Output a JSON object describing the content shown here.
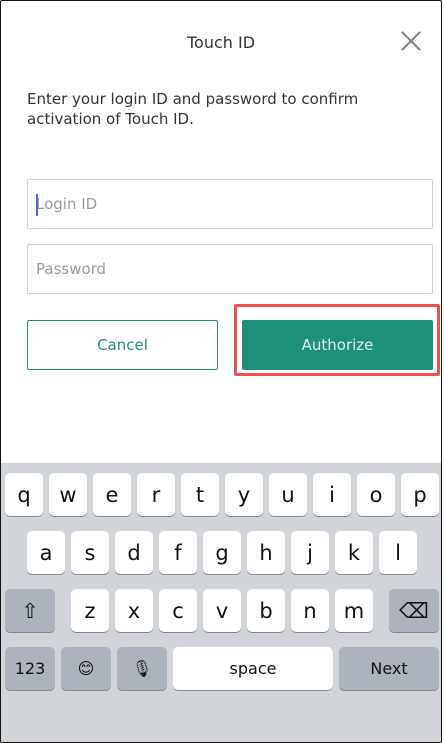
{
  "header": {
    "title": "Touch ID"
  },
  "description": "Enter your login ID and password to confirm activation of Touch ID.",
  "form": {
    "login_placeholder": "Login ID",
    "password_placeholder": "Password",
    "cancel_label": "Cancel",
    "authorize_label": "Authorize"
  },
  "keyboard": {
    "row1": [
      "q",
      "w",
      "e",
      "r",
      "t",
      "y",
      "u",
      "i",
      "o",
      "p"
    ],
    "row2": [
      "a",
      "s",
      "d",
      "f",
      "g",
      "h",
      "j",
      "k",
      "l"
    ],
    "row3": [
      "z",
      "x",
      "c",
      "v",
      "b",
      "n",
      "m"
    ],
    "numbers_label": "123",
    "space_label": "space",
    "next_label": "Next",
    "shift_icon": "⇧",
    "delete_icon": "⌫",
    "emoji_icon": "😊",
    "mic_icon": "🎙"
  },
  "colors": {
    "accent": "#1e8f78",
    "highlight": "#ef4f4f"
  }
}
